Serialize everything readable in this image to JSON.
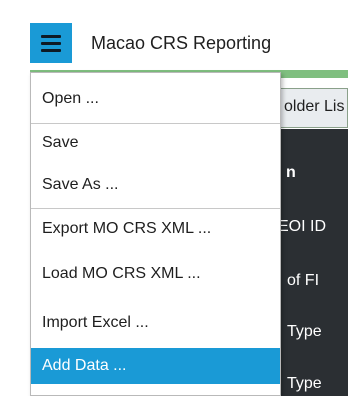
{
  "header": {
    "title": "Macao CRS Reporting",
    "menu_icon": "hamburger-icon",
    "accent_color": "#1a9ad6"
  },
  "background": {
    "tab_label": "older Lis",
    "panel_heading": "n",
    "panel_rows": [
      "EOI ID",
      "of FI",
      "Type",
      "Type"
    ]
  },
  "menu": {
    "items": [
      {
        "label": "Open ..."
      },
      {
        "label": "Save"
      },
      {
        "label": "Save As ..."
      },
      {
        "label": "Export MO CRS XML ..."
      },
      {
        "label": "Load MO CRS XML ..."
      },
      {
        "label": "Import Excel ..."
      },
      {
        "label": "Add Data ..."
      }
    ],
    "highlighted": "Add Data ..."
  }
}
